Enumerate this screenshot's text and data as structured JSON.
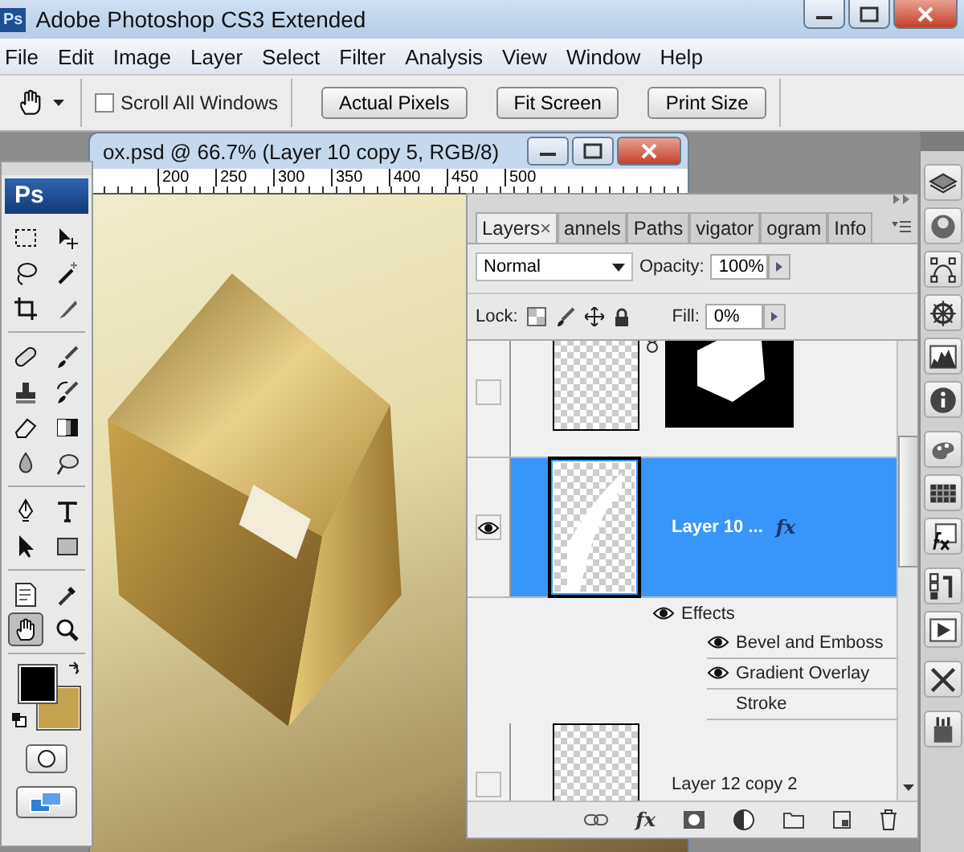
{
  "app": {
    "title": "Adobe Photoshop CS3 Extended",
    "logo": "Ps"
  },
  "menu": [
    "File",
    "Edit",
    "Image",
    "Layer",
    "Select",
    "Filter",
    "Analysis",
    "View",
    "Window",
    "Help"
  ],
  "options": {
    "scroll_all": {
      "label": "Scroll All Windows",
      "checked": false
    },
    "buttons": [
      "Actual Pixels",
      "Fit Screen",
      "Print Size"
    ]
  },
  "document": {
    "title": "ox.psd @ 66.7% (Layer 10 copy 5, RGB/8)",
    "ruler": [
      "200",
      "250",
      "300",
      "350",
      "400",
      "450",
      "500"
    ]
  },
  "toolbox": {
    "logo": "Ps",
    "groups": [
      [
        {
          "kind": "marquee",
          "selected": false
        },
        {
          "kind": "move",
          "selected": false
        },
        {
          "kind": "lasso",
          "selected": false
        },
        {
          "kind": "magic-wand",
          "selected": false
        },
        {
          "kind": "crop",
          "selected": false
        },
        {
          "kind": "slice",
          "selected": false
        }
      ],
      [
        {
          "kind": "healing",
          "selected": false
        },
        {
          "kind": "brush",
          "selected": false
        },
        {
          "kind": "stamp",
          "selected": false
        },
        {
          "kind": "history-brush",
          "selected": false
        },
        {
          "kind": "eraser",
          "selected": false
        },
        {
          "kind": "gradient",
          "selected": false
        },
        {
          "kind": "blur",
          "selected": false
        },
        {
          "kind": "dodge",
          "selected": false
        }
      ],
      [
        {
          "kind": "pen",
          "selected": false
        },
        {
          "kind": "type",
          "selected": false
        },
        {
          "kind": "path-select",
          "selected": false
        },
        {
          "kind": "shape",
          "selected": false
        }
      ],
      [
        {
          "kind": "notes",
          "selected": false
        },
        {
          "kind": "eyedropper",
          "selected": false
        },
        {
          "kind": "hand",
          "selected": true
        },
        {
          "kind": "zoom",
          "selected": false
        }
      ]
    ]
  },
  "panel": {
    "tabs": [
      {
        "label": "Layers",
        "close": "×",
        "selected": true
      },
      {
        "label": "annels",
        "selected": false
      },
      {
        "label": "Paths",
        "selected": false
      },
      {
        "label": "vigator",
        "selected": false
      },
      {
        "label": "ogram",
        "selected": false
      },
      {
        "label": "Info",
        "selected": false
      }
    ],
    "blend_mode": "Normal",
    "opacity_label": "Opacity:",
    "opacity": "100%",
    "lock_label": "Lock:",
    "fill_label": "Fill:",
    "fill": "0%",
    "layers": [
      {
        "kind": "masked",
        "visible": false,
        "selected": false
      },
      {
        "kind": "layer",
        "name": "Layer 10 ...",
        "fx": "fx",
        "visible": true,
        "selected": true,
        "effects": [
          {
            "name": "Effects",
            "visible": true
          },
          {
            "name": "Bevel and Emboss",
            "visible": true
          },
          {
            "name": "Gradient Overlay",
            "visible": true
          },
          {
            "name": "Stroke",
            "visible": false
          }
        ]
      },
      {
        "kind": "layer",
        "name": "Layer 12 copy 2",
        "visible": false,
        "selected": false
      }
    ],
    "footer_fx": "fx"
  }
}
